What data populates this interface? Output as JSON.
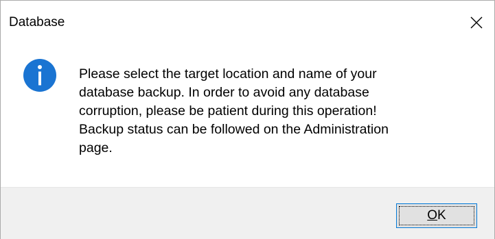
{
  "window": {
    "title": "Database",
    "close_icon": "close-icon"
  },
  "content": {
    "icon": "info-icon",
    "icon_color": "#1a74d2",
    "message_lines": [
      "Please select the target location and name of your",
      "database backup. In order to avoid any database",
      "corruption, please be patient during this operation!",
      "Backup status can be followed on the Administration",
      "page."
    ]
  },
  "buttons": {
    "ok_mnemonic": "O",
    "ok_rest": "K",
    "accent": "#0078d7"
  }
}
